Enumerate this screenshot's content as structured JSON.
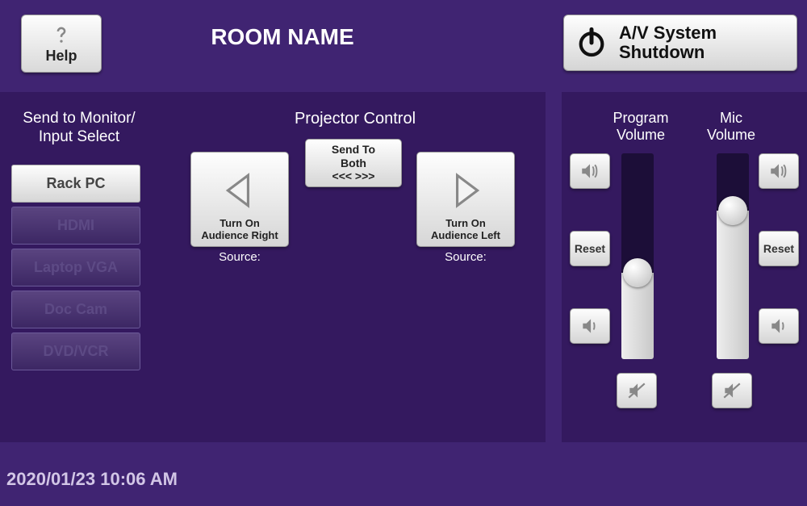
{
  "header": {
    "help_label": "Help",
    "room_title": "ROOM NAME",
    "shutdown_line1": "A/V System",
    "shutdown_line2": "Shutdown"
  },
  "input_select": {
    "title_line1": "Send to Monitor/",
    "title_line2": "Input Select",
    "items": [
      {
        "label": "Rack PC",
        "active": true
      },
      {
        "label": "HDMI",
        "active": false
      },
      {
        "label": "Laptop VGA",
        "active": false
      },
      {
        "label": "Doc Cam",
        "active": false
      },
      {
        "label": "DVD/VCR",
        "active": false
      }
    ]
  },
  "projector": {
    "title": "Projector Control",
    "left": {
      "line1": "Turn On",
      "line2": "Audience Right",
      "source_label": "Source:"
    },
    "right": {
      "line1": "Turn On",
      "line2": "Audience Left",
      "source_label": "Source:"
    },
    "send_both": {
      "line1": "Send To",
      "line2": "Both",
      "line3": "<<<    >>>"
    }
  },
  "volume": {
    "program": {
      "title_line1": "Program",
      "title_line2": "Volume",
      "reset_label": "Reset",
      "level_percent": 42
    },
    "mic": {
      "title_line1": "Mic",
      "title_line2": "Volume",
      "reset_label": "Reset",
      "level_percent": 72
    }
  },
  "footer": {
    "timestamp": "2020/01/23 10:06 AM"
  },
  "icons": {
    "help": "question-icon",
    "power": "power-icon",
    "arrow_left": "triangle-left-icon",
    "arrow_right": "triangle-right-icon",
    "speaker_up": "speaker-loud-icon",
    "speaker_down": "speaker-soft-icon",
    "speaker_mute": "speaker-mute-icon"
  }
}
